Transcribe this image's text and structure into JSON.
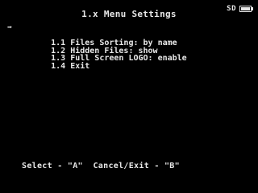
{
  "header": {
    "title": "1.x Menu Settings",
    "storage_label": "SD",
    "storage_icon": "sd-card-icon",
    "battery_icon": "battery-icon",
    "battery_level": 1.0
  },
  "menu": {
    "cursor_glyph": "➡",
    "selected_index": 0,
    "items": [
      {
        "label": "1.1 Files Sorting: by name"
      },
      {
        "label": "1.2 Hidden Files: show"
      },
      {
        "label": "1.3 Full Screen LOGO: enable"
      },
      {
        "label": "1.4 Exit"
      }
    ]
  },
  "footer": {
    "hint": "Select - \"A\"  Cancel/Exit - \"B\""
  }
}
